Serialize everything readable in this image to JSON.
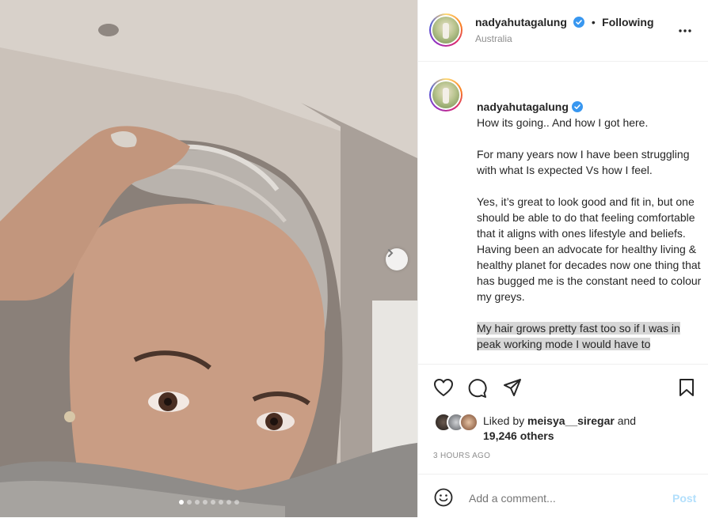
{
  "post": {
    "username": "nadyahutagalung",
    "follow_sep": "•",
    "following_label": "Following",
    "location": "Australia",
    "more_icon": "more-horizontal-icon",
    "carousel": {
      "dot_count": 8,
      "active_index": 0,
      "next_icon": "chevron-right-icon"
    }
  },
  "caption": {
    "first_line": "How its going.. And how I got here.",
    "paragraphs": [
      "For many years now I have been struggling with what Is expected Vs how I feel.",
      "Yes, it’s great to look good and fit in, but one should be able to do that feeling comfortable that it aligns with ones lifestyle and beliefs.",
      "Having been an advocate for healthy living & healthy planet for decades now one thing that has bugged me is the constant need to colour my greys.",
      "My hair grows pretty fast too so if I was in peak working mode I would have to"
    ]
  },
  "likes": {
    "liked_by_prefix": "Liked by",
    "liked_by_user": "meisya__siregar",
    "and": "and",
    "others": "19,246 others"
  },
  "time_ago": "3 HOURS AGO",
  "comment": {
    "placeholder": "Add a comment...",
    "post_label": "Post"
  },
  "colors": {
    "verified": "#3897f0",
    "post_disabled": "#b2dffc",
    "muted": "#8e8e8e"
  }
}
